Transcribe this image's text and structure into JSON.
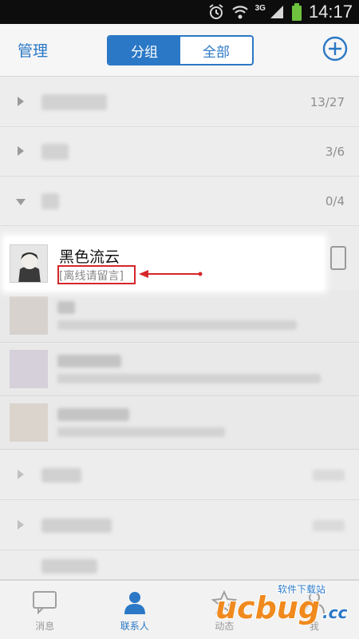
{
  "status_bar": {
    "network": "3G",
    "time": "14:17"
  },
  "header": {
    "manage_label": "管理",
    "segments": [
      "分组",
      "全部"
    ],
    "active_segment": "分组"
  },
  "groups": [
    {
      "count": "13/27",
      "expanded": false
    },
    {
      "count": "3/6",
      "expanded": false
    },
    {
      "count": "0/4",
      "expanded": true
    }
  ],
  "highlight_contact": {
    "name": "黑色流云",
    "status": "[离线请留言]"
  },
  "tabbar": {
    "tabs": [
      "消息",
      "联系人",
      "动态",
      "我"
    ],
    "active_tab": "联系人"
  },
  "watermark": {
    "text": "ucbug",
    "suffix": ".cc",
    "subtext": "软件下载站"
  },
  "colors": {
    "accent": "#2a78c6",
    "annotation": "#d5262b"
  }
}
